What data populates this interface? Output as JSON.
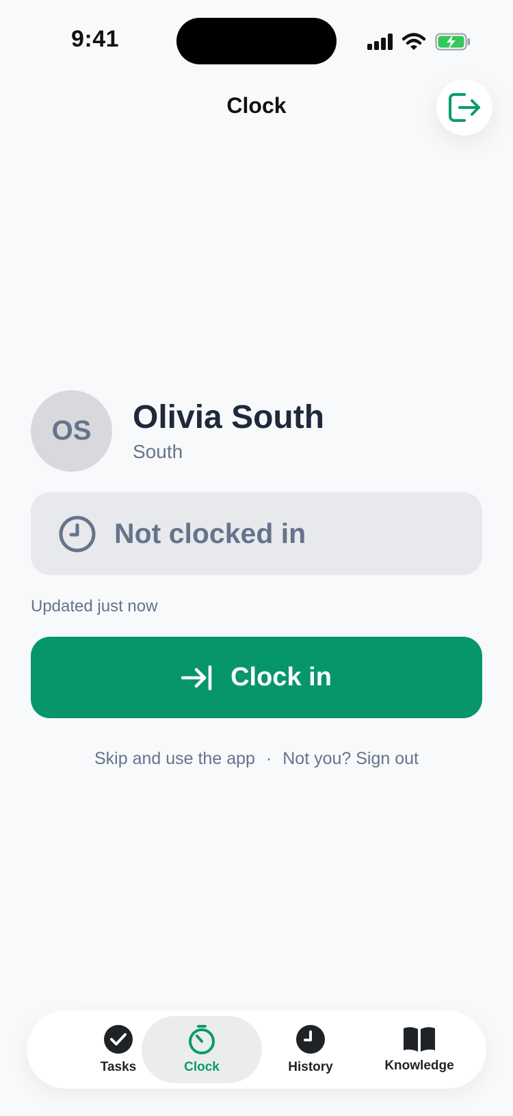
{
  "status_bar": {
    "time": "9:41"
  },
  "header": {
    "title": "Clock"
  },
  "user": {
    "initials": "OS",
    "name": "Olivia South",
    "location": "South"
  },
  "status": {
    "text": "Not clocked in",
    "updated": "Updated just now"
  },
  "actions": {
    "clock_in": "Clock in"
  },
  "footer": {
    "skip": "Skip and use the app",
    "separator": "·",
    "sign_out": "Not you? Sign out"
  },
  "tabs": [
    {
      "label": "Tasks",
      "icon": "check-circle-icon",
      "active": false
    },
    {
      "label": "Clock",
      "icon": "stopwatch-icon",
      "active": true
    },
    {
      "label": "History",
      "icon": "clock-icon",
      "active": false
    },
    {
      "label": "Knowledge",
      "icon": "book-icon",
      "active": false
    }
  ],
  "colors": {
    "accent": "#07966a",
    "muted": "#64748b",
    "background": "#f8f9fb",
    "battery": "#34c759"
  }
}
